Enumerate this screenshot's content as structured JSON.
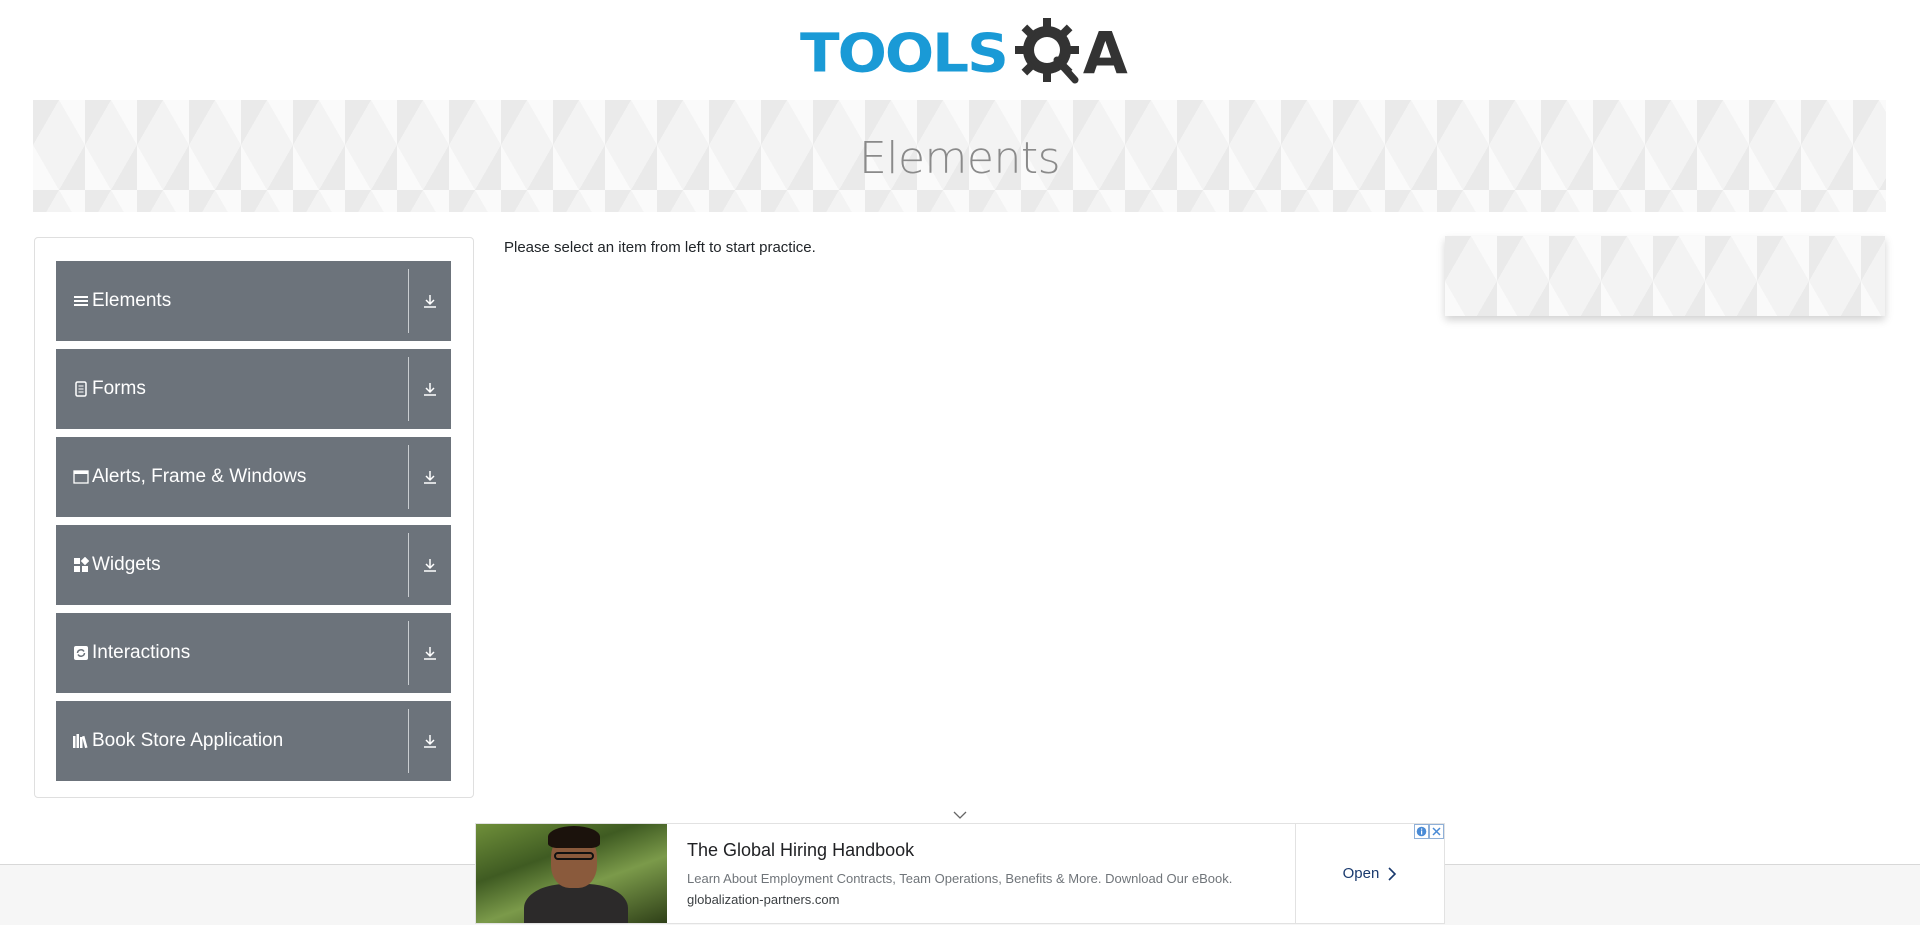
{
  "header": {
    "logo_primary": "TOOLS",
    "logo_secondary": "A",
    "logo_brand_color": "#1a9ad6"
  },
  "banner": {
    "title": "Elements"
  },
  "sidebar": {
    "groups": [
      {
        "label": "Elements",
        "icon": "hamburger-icon"
      },
      {
        "label": "Forms",
        "icon": "document-icon"
      },
      {
        "label": "Alerts, Frame & Windows",
        "icon": "window-icon"
      },
      {
        "label": "Widgets",
        "icon": "grid-icon"
      },
      {
        "label": "Interactions",
        "icon": "refresh-icon"
      },
      {
        "label": "Book Store Application",
        "icon": "books-icon"
      }
    ],
    "group_color": "#6c737b",
    "toggle_icon": "download-icon"
  },
  "main": {
    "instruction": "Please select an item from left to start practice."
  },
  "ad": {
    "title": "The Global Hiring Handbook",
    "description": "Learn About Employment Contracts, Team Operations, Benefits & More. Download Our eBook.",
    "domain": "globalization-partners.com",
    "cta": "Open"
  }
}
